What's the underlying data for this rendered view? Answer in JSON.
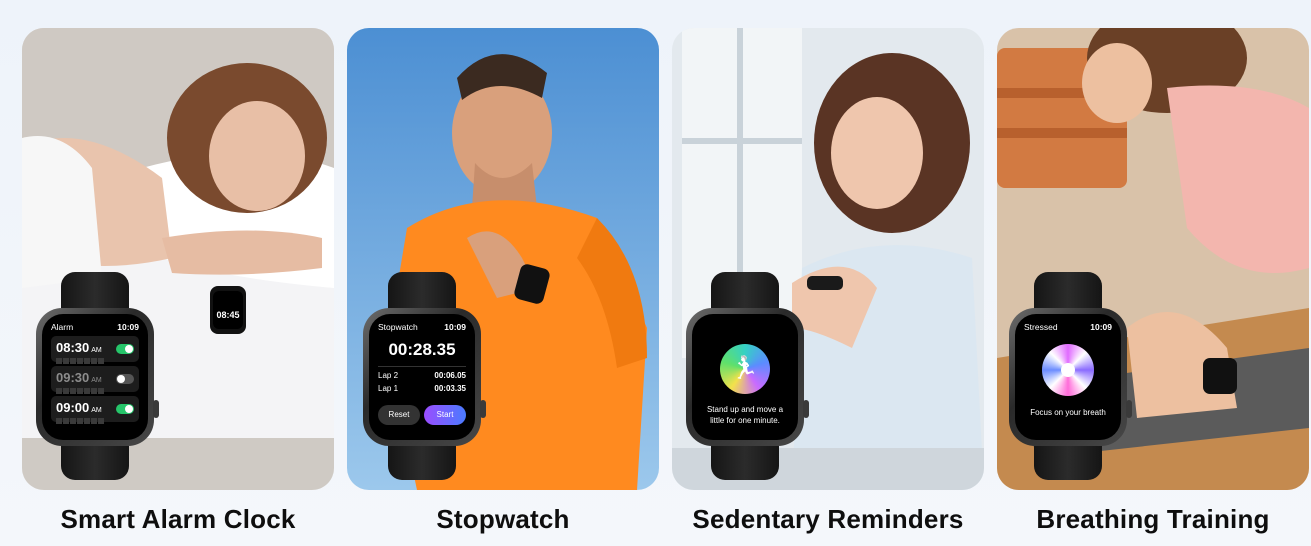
{
  "panels": [
    {
      "caption": "Smart Alarm Clock"
    },
    {
      "caption": "Stopwatch"
    },
    {
      "caption": "Sedentary Reminders"
    },
    {
      "caption": "Breathing Training"
    }
  ],
  "alarm_screen": {
    "title": "Alarm",
    "clock": "10:09",
    "rows": [
      {
        "time": "08:30",
        "ampm": "AM",
        "on": true
      },
      {
        "time": "09:30",
        "ampm": "AM",
        "on": false
      },
      {
        "time": "09:00",
        "ampm": "AM",
        "on": true
      }
    ],
    "wrist_time": "08:45"
  },
  "stopwatch_screen": {
    "title": "Stopwatch",
    "clock": "10:09",
    "elapsed": "00:28.35",
    "laps": [
      {
        "label": "Lap 2",
        "value": "00:06.05"
      },
      {
        "label": "Lap 1",
        "value": "00:03.35"
      }
    ],
    "reset_label": "Reset",
    "start_label": "Start"
  },
  "sedentary_screen": {
    "message": "Stand up and move a little for one minute."
  },
  "breathing_screen": {
    "title": "Stressed",
    "clock": "10:09",
    "message": "Focus on your breath"
  }
}
